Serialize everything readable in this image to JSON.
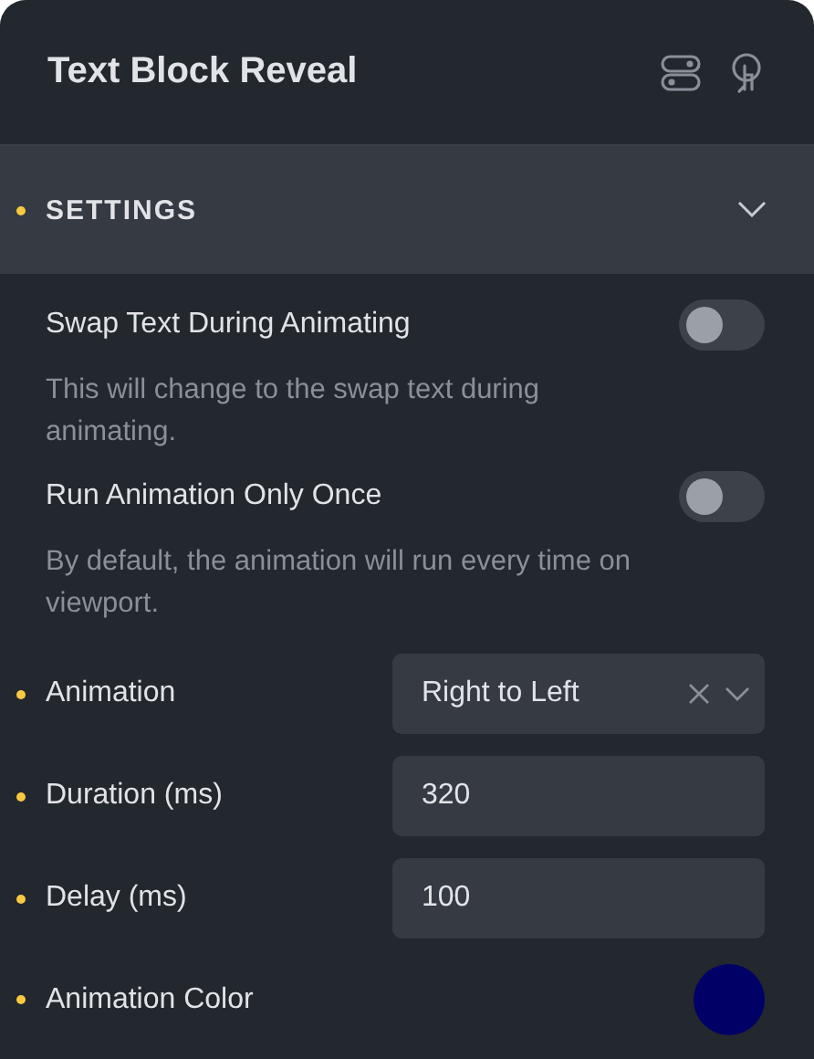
{
  "panel": {
    "title": "Text Block Reveal"
  },
  "section": {
    "label": "SETTINGS",
    "modified": true,
    "expanded": true
  },
  "controls": [
    {
      "kind": "toggle",
      "label": "Swap Text During Animating",
      "on": false,
      "description": "This will change to the swap text during animating.",
      "modified": false
    },
    {
      "kind": "toggle",
      "label": "Run Animation Only Once",
      "on": false,
      "description": "By default, the animation will run every time on viewport.",
      "modified": false
    },
    {
      "kind": "select",
      "label": "Animation",
      "value": "Right to Left",
      "modified": true
    },
    {
      "kind": "number",
      "label": "Duration (ms)",
      "value": "320",
      "modified": true
    },
    {
      "kind": "number",
      "label": "Delay (ms)",
      "value": "100",
      "modified": true
    },
    {
      "kind": "color",
      "label": "Animation Color",
      "color": "#000066",
      "modified": true
    }
  ]
}
